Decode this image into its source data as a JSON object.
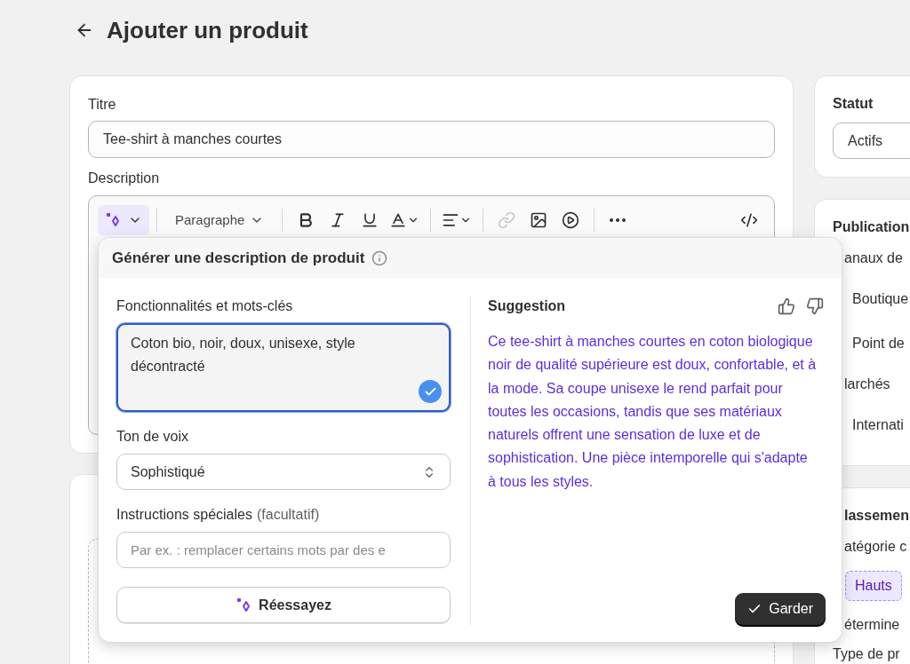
{
  "page": {
    "title": "Ajouter un produit"
  },
  "product_card": {
    "title_label": "Titre",
    "title_value": "Tee-shirt à manches courtes",
    "description_label": "Description",
    "toolbar": [
      {
        "kind": "ai",
        "disabled": false
      },
      {
        "kind": "divider"
      },
      {
        "kind": "style",
        "label": "Paragraphe",
        "disabled": false
      },
      {
        "kind": "divider"
      },
      {
        "kind": "bold",
        "disabled": false
      },
      {
        "kind": "italic",
        "disabled": false
      },
      {
        "kind": "underline",
        "disabled": false
      },
      {
        "kind": "color",
        "disabled": false
      },
      {
        "kind": "divider"
      },
      {
        "kind": "align",
        "disabled": false
      },
      {
        "kind": "divider"
      },
      {
        "kind": "link",
        "disabled": true
      },
      {
        "kind": "image",
        "disabled": false
      },
      {
        "kind": "video",
        "disabled": false
      },
      {
        "kind": "divider"
      },
      {
        "kind": "more",
        "disabled": false
      },
      {
        "kind": "code",
        "disabled": false
      }
    ]
  },
  "generator": {
    "title": "Générer une description de produit",
    "keywords": {
      "label": "Fonctionnalités et mots-clés",
      "value": "Coton bio, noir, doux, unisexe, style décontracté",
      "focused": true,
      "valid": true
    },
    "tone": {
      "label": "Ton de voix",
      "value": "Sophistiqué"
    },
    "instructions": {
      "label": "Instructions spéciales",
      "hint": "(facultatif)",
      "placeholder": "Par ex. : remplacer certains mots par des e"
    },
    "retry_button": "Réessayez",
    "suggestion": {
      "title": "Suggestion",
      "text": "Ce tee-shirt à manches courtes en coton biologique noir de qualité supérieure est doux, confortable, et à la mode. Sa coupe unisexe le rend parfait pour toutes les occasions, tandis que ses matériaux naturels offrent une sensation de luxe et de sophistication. Une pièce intemporelle qui s'adapte à tous les styles.",
      "keep_button": "Garder"
    }
  },
  "sidebar": [
    {
      "items": [
        {
          "kind": "title",
          "text": "Statut"
        },
        {
          "kind": "select",
          "text": "Actifs"
        }
      ]
    },
    {
      "items": [
        {
          "kind": "title",
          "text": "Publication"
        },
        {
          "kind": "label",
          "text": "anaux de"
        },
        {
          "kind": "option",
          "text": "Boutique"
        },
        {
          "kind": "option",
          "text": "Point de"
        },
        {
          "kind": "label",
          "text": "larchés"
        },
        {
          "kind": "option",
          "text": "Internati"
        }
      ]
    },
    {
      "items": [
        {
          "kind": "heading",
          "text": "lassemen"
        },
        {
          "kind": "label",
          "text": "atégorie c"
        },
        {
          "kind": "chip",
          "text": "Hauts"
        },
        {
          "kind": "label",
          "text": "étermine"
        },
        {
          "kind": "caption",
          "text": "Type de pr"
        }
      ]
    }
  ]
}
